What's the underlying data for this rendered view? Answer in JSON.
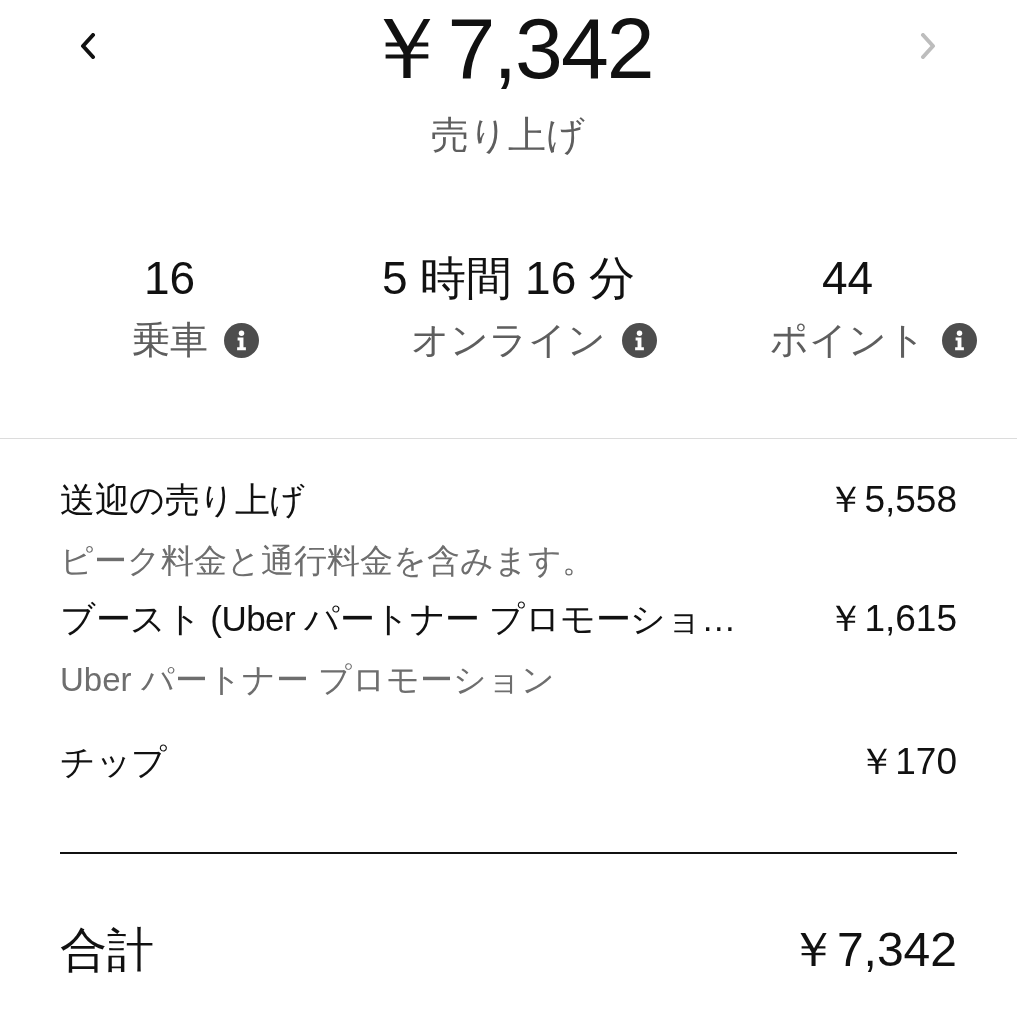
{
  "navigation": [
    {
      "kind": "prev",
      "disabled": false
    },
    {
      "kind": "next",
      "disabled": true
    }
  ],
  "earnings": {
    "amount": "￥7,342",
    "label": "売り上げ"
  },
  "stats": [
    {
      "value": "16",
      "label": "乗車",
      "info": true
    },
    {
      "value": "5 時間 16 分",
      "label": "オンライン",
      "info": true
    },
    {
      "value": "44",
      "label": "ポイント",
      "info": true
    }
  ],
  "breakdown": {
    "items": [
      {
        "label": "送迎の売り上げ",
        "amount": "￥5,558",
        "note": "ピーク料金と通行料金を含みます。"
      },
      {
        "label": "ブースト (Uber パートナー プロモーショ…",
        "amount": "￥1,615",
        "note": "Uber パートナー プロモーション"
      },
      {
        "label": "チップ",
        "amount": "￥170"
      }
    ],
    "total": {
      "label": "合計",
      "amount": "￥7,342"
    }
  }
}
